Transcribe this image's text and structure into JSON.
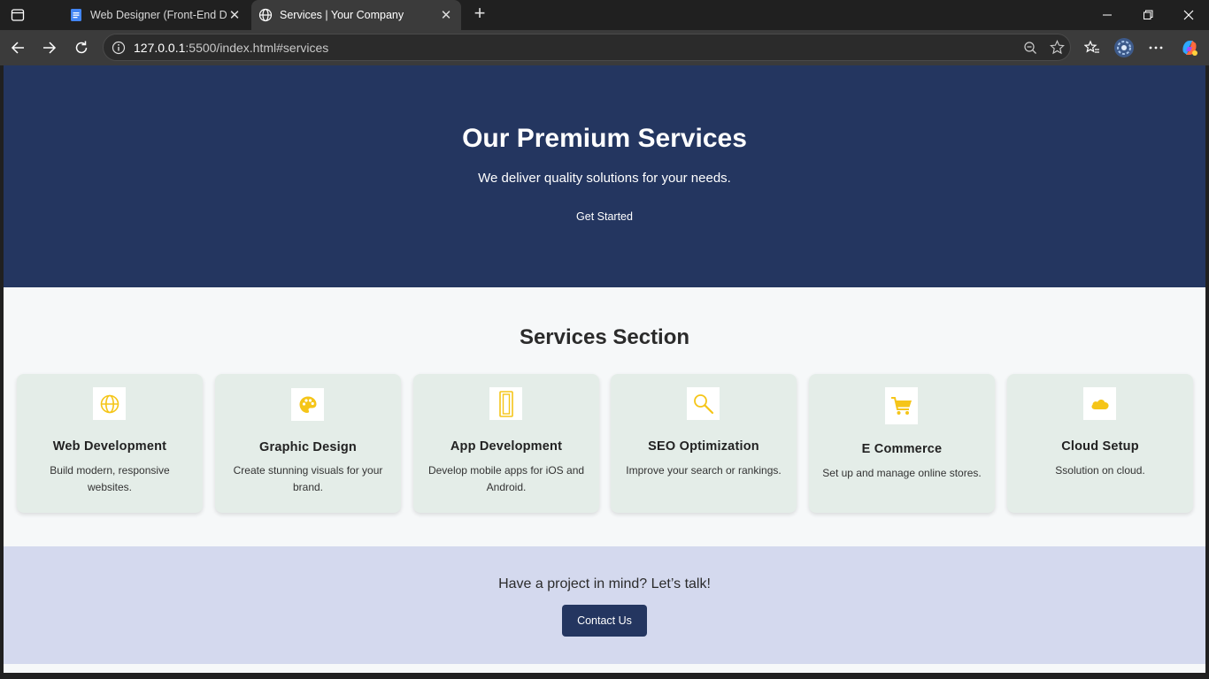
{
  "browser": {
    "tabs": [
      {
        "title": "Web Designer (Front-End Dev",
        "active": false
      },
      {
        "title": "Services | Your Company",
        "active": true
      }
    ],
    "url_host": "127.0.0.1",
    "url_rest": ":5500/index.html#services",
    "icons": [
      "sidebar-icon",
      "docs-icon",
      "globe-icon",
      "close-icon",
      "new-tab-icon",
      "minimize-icon",
      "restore-icon",
      "close-window-icon",
      "back-icon",
      "forward-icon",
      "refresh-icon",
      "site-info-icon",
      "zoom-icon",
      "favorite-star-icon",
      "favorites-icon",
      "profile-avatar-icon",
      "more-icon",
      "copilot-icon"
    ]
  },
  "hero": {
    "title": "Our Premium Services",
    "subtitle": "We deliver quality solutions for your needs.",
    "cta": "Get Started"
  },
  "services": {
    "heading": "Services Section",
    "cards": [
      {
        "title": "Web Development",
        "desc": "Build modern, responsive websites.",
        "icon": "globe-icon"
      },
      {
        "title": "Graphic Design",
        "desc": "Create stunning visuals for your brand.",
        "icon": "palette-icon"
      },
      {
        "title": "App Development",
        "desc": "Develop mobile apps for iOS and Android.",
        "icon": "mobile-icon"
      },
      {
        "title": "SEO Optimization",
        "desc": "Improve your search or rankings.",
        "icon": "search-icon"
      },
      {
        "title": "E Commerce",
        "desc": "Set up and manage online stores.",
        "icon": "cart-icon"
      },
      {
        "title": "Cloud Setup",
        "desc": "Ssolution on cloud.",
        "icon": "cloud-icon"
      }
    ]
  },
  "contact": {
    "text": "Have a project in mind? Let’s talk!",
    "button": "Contact Us"
  },
  "colors": {
    "hero_bg": "#243660",
    "icon_accent": "#f5c518",
    "card_bg": "#e4ede8",
    "contact_bg": "#d4d9ee"
  }
}
